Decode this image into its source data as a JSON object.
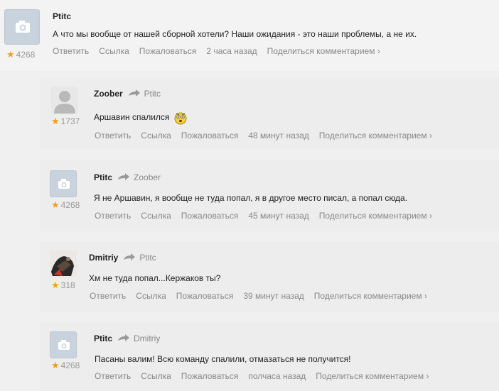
{
  "actions": {
    "reply": "Ответить",
    "link": "Ссылка",
    "report": "Пожаловаться",
    "share": "Поделиться комментарием ›"
  },
  "comments": [
    {
      "author": "Ptitc",
      "reply_to": "",
      "rating": "4268",
      "text": "А что мы вообще от нашей сборной хотели? Наши ожидания - это наши проблемы, а не их.",
      "time": "2 часа назад",
      "avatar": "camera-icon"
    },
    {
      "author": "Zoober",
      "reply_to": "Ptitc",
      "rating": "1737",
      "text": "Аршавин спалился",
      "time": "48 минут назад",
      "avatar": "person-silhouette"
    },
    {
      "author": "Ptitc",
      "reply_to": "Zoober",
      "rating": "4268",
      "text": "Я не Аршавин, я вообще не туда попал, я в другое место писал, а попал сюда.",
      "time": "45 минут назад",
      "avatar": "camera-icon"
    },
    {
      "author": "Dmitriy",
      "reply_to": "Ptitc",
      "rating": "318",
      "text": "Хм не туда попал...Кержаков ты?",
      "time": "39 минут назад",
      "avatar": "user-photo"
    },
    {
      "author": "Ptitc",
      "reply_to": "Dmitriy",
      "rating": "4268",
      "text": "Пасаны валим! Всю команду спалили, отмазаться не получится!",
      "time": "полчаса назад",
      "avatar": "camera-icon"
    }
  ]
}
